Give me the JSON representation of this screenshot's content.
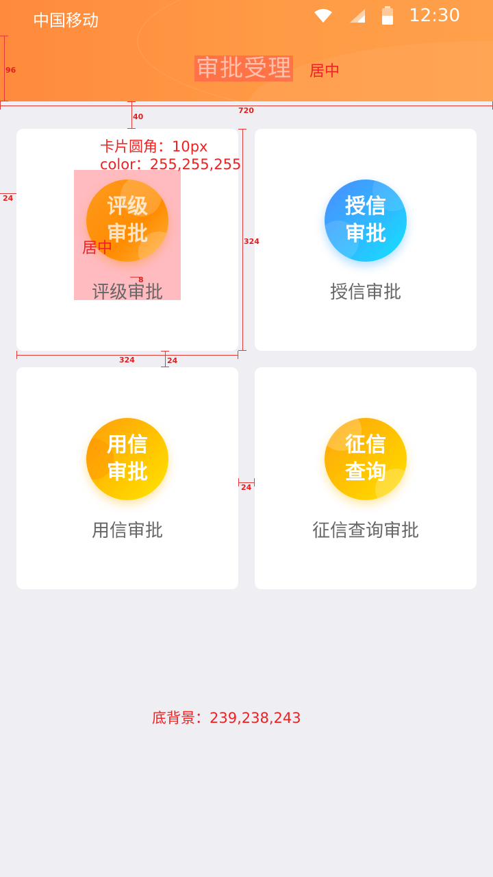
{
  "status_bar": {
    "carrier": "中国移动",
    "time": "12:30",
    "icons": [
      "wifi-icon",
      "signal-icon",
      "battery-icon"
    ]
  },
  "header": {
    "title": "审批受理",
    "background_color": "#ff9440"
  },
  "cards": [
    {
      "icon_text": "评级审批",
      "label": "评级审批",
      "icon_colors": [
        "#ff9a1f",
        "#ff8c00"
      ]
    },
    {
      "icon_text": "授信审批",
      "label": "授信审批",
      "icon_colors": [
        "#4a8cff",
        "#12e4ff"
      ]
    },
    {
      "icon_text": "用信审批",
      "label": "用信审批",
      "icon_colors": [
        "#ff9e0e",
        "#ffe500"
      ]
    },
    {
      "icon_text": "征信查询",
      "label": "征信查询审批",
      "icon_colors": [
        "#ffa20c",
        "#ffe000"
      ]
    }
  ],
  "annotations": {
    "header_height": "96",
    "title_center": "居中",
    "page_width": "720",
    "top_gap": "40",
    "card_radius": "卡片圆角：10px",
    "card_color": "color：255,255,255",
    "side_margin": "24",
    "card_height": "324",
    "icon_center": "居中",
    "icon_gap": "8",
    "card_width": "324",
    "row_gap": "24",
    "col_gap": "24",
    "page_bg": "底背景：239,238,243"
  },
  "page_background": "#efeef3"
}
